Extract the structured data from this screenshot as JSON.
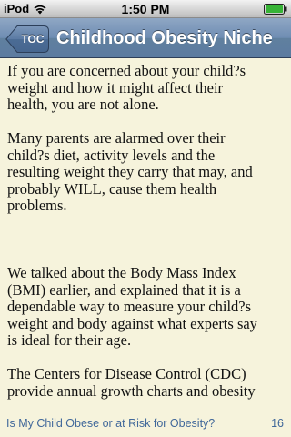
{
  "status_bar": {
    "carrier": "iPod",
    "wifi_icon": "wifi-icon",
    "time": "1:50 PM",
    "battery_icon": "battery-icon"
  },
  "nav": {
    "back_label": "TOC",
    "title": "Childhood Obesity Niche",
    "bar_color": "#6f8db3"
  },
  "content": {
    "paragraphs": [
      "If you are concerned about your child?s\nweight and how it might affect their\nhealth, you are not alone.",
      "Many parents are alarmed over their\nchild?s diet, activity levels and the\nresulting weight they carry that may, and\nprobably WILL, cause them health\nproblems.",
      "We talked about the Body Mass Index\n(BMI) earlier, and explained that it is a\ndependable way to measure your child?s\nweight and body against what experts say\nis ideal for their age.",
      "The Centers for Disease Control (CDC)\nprovide annual growth charts and obesity"
    ]
  },
  "footer": {
    "chapter_title": "Is My Child Obese or at Risk for Obesity?",
    "page_number": "16",
    "link_color": "#41689a"
  },
  "colors": {
    "page_background": "#f6f3dc"
  }
}
